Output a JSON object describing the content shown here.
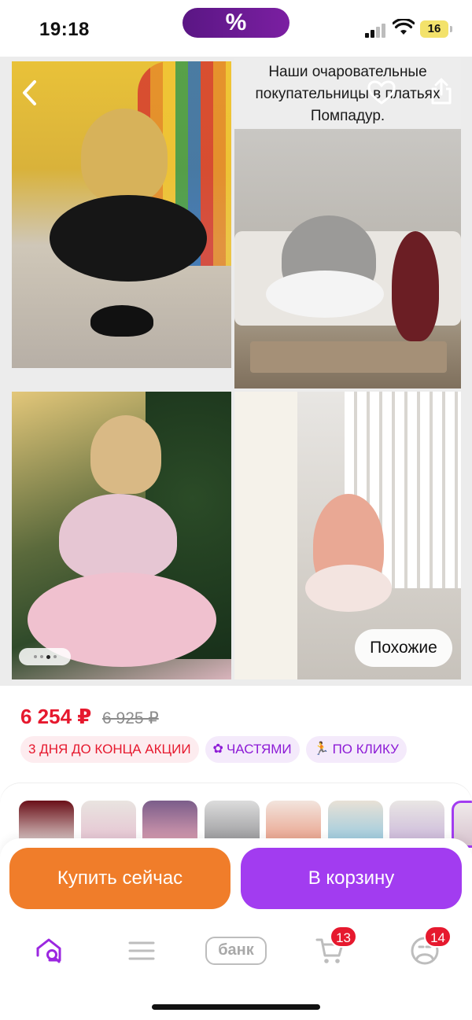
{
  "status_bar": {
    "time": "19:18",
    "promo_symbol": "%",
    "battery": "16"
  },
  "gallery": {
    "caption": "Наши очаровательные покупательницы в платьях Помпадур.",
    "similar_label": "Похожие",
    "dots_total": 4,
    "dots_active": 3
  },
  "product": {
    "price": "6 254 ₽",
    "old_price": "6 925 ₽",
    "badges": [
      {
        "label": "3 ДНЯ ДО КОНЦА АКЦИИ",
        "style": "red",
        "icon": ""
      },
      {
        "label": "ЧАСТЯМИ",
        "style": "purple",
        "icon": "clover-icon"
      },
      {
        "label": "ПО КЛИКУ",
        "style": "purple",
        "icon": "runner-icon"
      }
    ]
  },
  "thumbnails": {
    "count": 8,
    "selected_index": 7
  },
  "actions": {
    "buy_now": "Купить сейчас",
    "add_to_cart": "В корзину"
  },
  "nav": {
    "bank_label": "банк",
    "cart_count": "13",
    "profile_count": "14"
  },
  "colors": {
    "price_red": "#e6192e",
    "orange": "#f07d2a",
    "purple": "#a23cf0",
    "promo_purple": "#6a1b9a"
  }
}
